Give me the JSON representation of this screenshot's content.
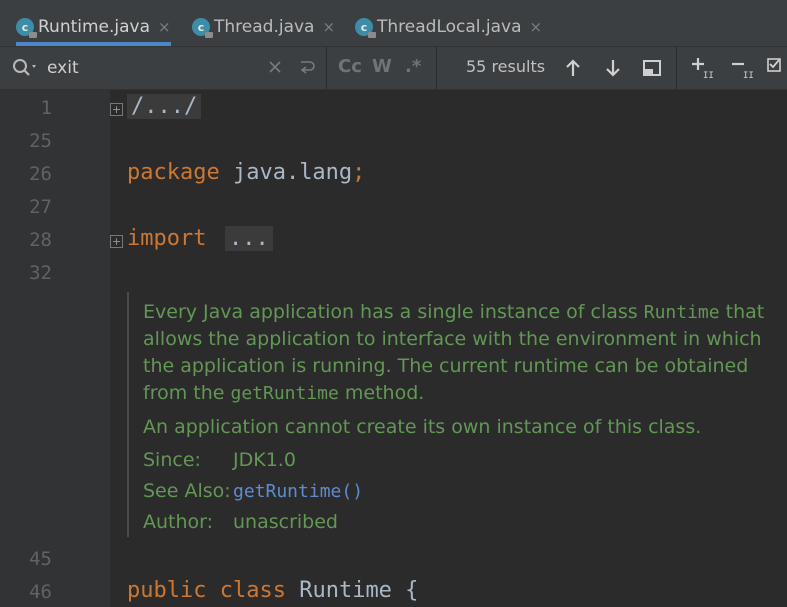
{
  "tabs": [
    {
      "label": "Runtime.java",
      "icon": "class-icon",
      "active": true
    },
    {
      "label": "Thread.java",
      "icon": "class-icon",
      "active": false
    },
    {
      "label": "ThreadLocal.java",
      "icon": "class-icon",
      "active": false
    }
  ],
  "tab_icon_letter": "c",
  "tab_close": "×",
  "search": {
    "value": "exit",
    "results": "55 results",
    "match_case_label": "Cc",
    "words_label": "W",
    "regex_label": ".*"
  },
  "editor": {
    "lines": {
      "l1": "1",
      "l25": "25",
      "l26": "26",
      "l27": "27",
      "l28": "28",
      "l32": "32",
      "l45": "45",
      "l46": "46"
    },
    "fold_header": "/.../",
    "package_kw": "package",
    "package_name": " java.lang;",
    "package_semicolon": ";",
    "import_kw": "import",
    "import_fold": "...",
    "class_public": "public",
    "class_kw": "class",
    "class_name": " Runtime {"
  },
  "doc": {
    "p1_a": "Every Java application has a single instance of class ",
    "p1_code": "Runtime",
    "p1_b": " that",
    "p2": "allows the application to interface with the environment in which",
    "p3": "the application is running. The current runtime can be obtained",
    "p4_a": "from the ",
    "p4_code": "getRuntime",
    "p4_b": " method.",
    "p5": "An application cannot create its own instance of this class.",
    "since_label": "Since:",
    "since_value": "JDK1.0",
    "see_label": "See Also:",
    "see_value": "getRuntime()",
    "author_label": "Author:",
    "author_value": "unascribed"
  }
}
